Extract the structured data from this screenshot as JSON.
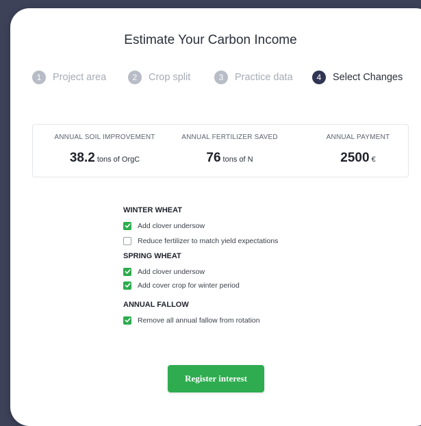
{
  "title": "Estimate Your Carbon Income",
  "steps": [
    {
      "num": "1",
      "label": "Project area",
      "active": false
    },
    {
      "num": "2",
      "label": "Crop split",
      "active": false
    },
    {
      "num": "3",
      "label": "Practice data",
      "active": false
    },
    {
      "num": "4",
      "label": "Select Changes",
      "active": true
    }
  ],
  "stats": [
    {
      "caption": "ANNUAL SOIL IMPROVEMENT",
      "value": "38.2",
      "unit": "tons of OrgC"
    },
    {
      "caption": "ANNUAL FERTILIZER SAVED",
      "value": "76",
      "unit": "tons of N"
    },
    {
      "caption": "ANNUAL PAYMENT",
      "value": "2500",
      "unit": "€"
    }
  ],
  "groups": [
    {
      "title": "WINTER WHEAT",
      "options": [
        {
          "label": "Add clover undersow",
          "checked": true
        },
        {
          "label": "Reduce fertilizer to match yield expectations",
          "checked": false
        }
      ]
    },
    {
      "title": "SPRING WHEAT",
      "options": [
        {
          "label": "Add clover undersow",
          "checked": true
        },
        {
          "label": "Add cover crop for winter period",
          "checked": true
        }
      ]
    },
    {
      "title": "ANNUAL FALLOW",
      "options": [
        {
          "label": "Remove all annual fallow from rotation",
          "checked": true
        }
      ]
    }
  ],
  "register_label": "Register interest",
  "colors": {
    "accent": "#2eac4f",
    "active_step": "#2f3552",
    "inactive_step": "#b7bcc6",
    "background": "#3d4259"
  }
}
